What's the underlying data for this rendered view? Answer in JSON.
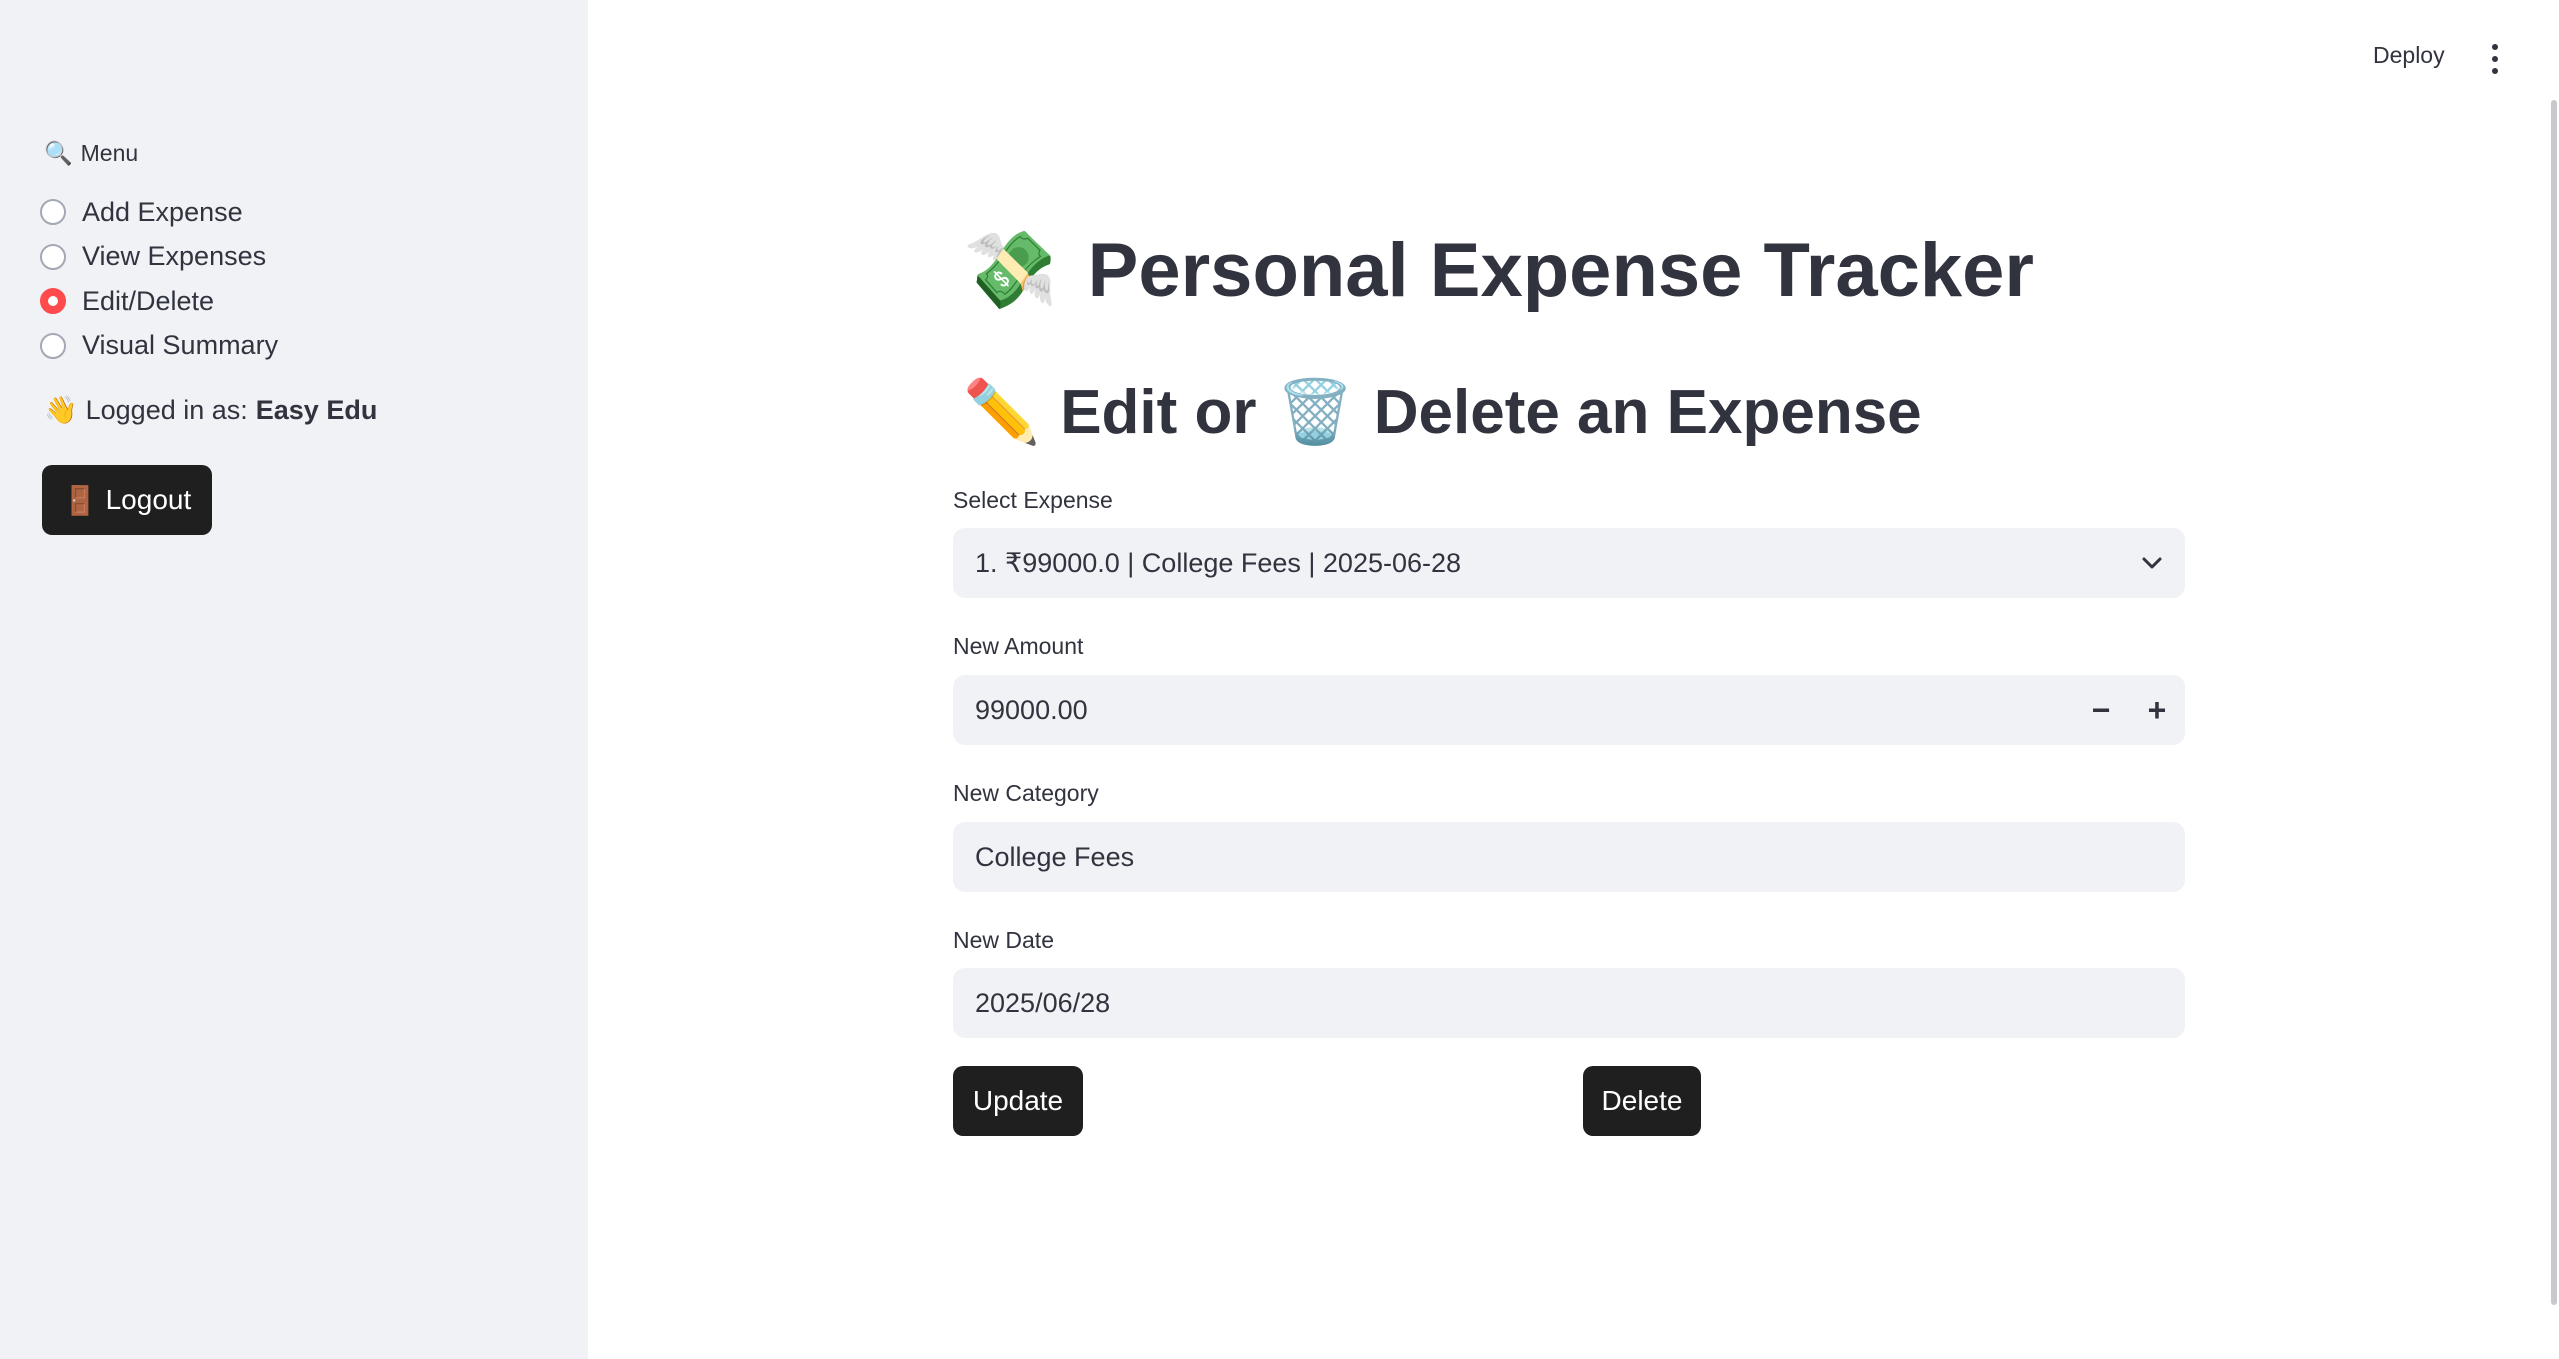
{
  "sidebar": {
    "menu_icon": "magnifier-icon",
    "menu_icon_glyph": "🔍",
    "menu_title": "Menu",
    "items": [
      {
        "label": "Add Expense",
        "selected": false
      },
      {
        "label": "View Expenses",
        "selected": false
      },
      {
        "label": "Edit/Delete",
        "selected": true
      },
      {
        "label": "Visual Summary",
        "selected": false
      }
    ],
    "logged_in_icon_glyph": "👋",
    "logged_in_prefix": "Logged in as:",
    "logged_in_user": "Easy Edu",
    "logout_icon_glyph": "🚪",
    "logout_label": "Logout"
  },
  "header": {
    "deploy_label": "Deploy"
  },
  "main": {
    "title_icon_glyph": "💸",
    "title": "Personal Expense Tracker",
    "subtitle_edit_icon_glyph": "✏️",
    "subtitle_part1": "Edit or",
    "subtitle_delete_icon_glyph": "🗑️",
    "subtitle_part2": "Delete an Expense",
    "select_expense": {
      "label": "Select Expense",
      "value": "1. ₹99000.0 | College Fees | 2025-06-28"
    },
    "new_amount": {
      "label": "New Amount",
      "value": "99000.00",
      "minus": "−",
      "plus": "+"
    },
    "new_category": {
      "label": "New Category",
      "value": "College Fees"
    },
    "new_date": {
      "label": "New Date",
      "value": "2025/06/28"
    },
    "update_label": "Update",
    "delete_label": "Delete"
  },
  "colors": {
    "sidebar_bg": "#f0f2f6",
    "accent": "#ff4b4b",
    "button_bg": "#1f1f1f",
    "text": "#31333f"
  }
}
